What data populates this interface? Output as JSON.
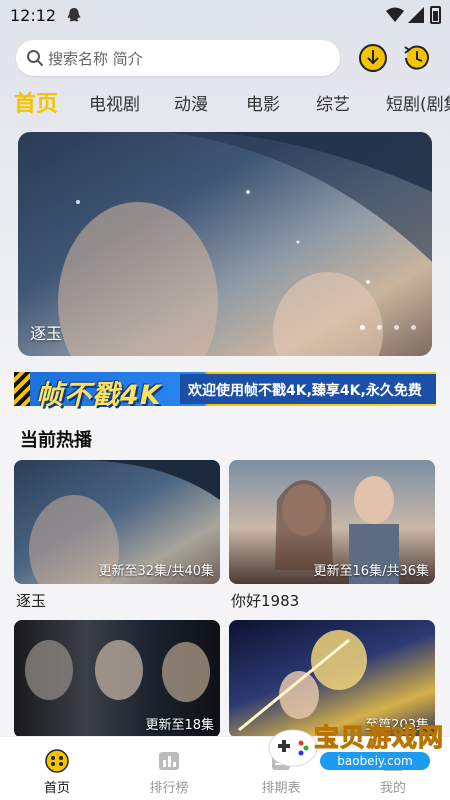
{
  "status_bar": {
    "time": "12:12"
  },
  "search": {
    "placeholder": "搜索名称 简介"
  },
  "tabs": [
    {
      "label": "首页",
      "active": true
    },
    {
      "label": "电视剧"
    },
    {
      "label": "动漫"
    },
    {
      "label": "电影"
    },
    {
      "label": "综艺"
    },
    {
      "label": "短剧(剧集"
    }
  ],
  "banner": {
    "title": "逐玉",
    "page_count": 4,
    "current_page": 1
  },
  "promo": {
    "left_text": "帧不戳4K",
    "right_text": "欢迎使用帧不戳4K,臻享4K,永久免费"
  },
  "section": {
    "title": "当前热播"
  },
  "cards": [
    {
      "title": "逐玉",
      "status": "更新至32集/共40集"
    },
    {
      "title": "你好1983",
      "status": "更新至16集/共36集"
    },
    {
      "title": "",
      "status": "更新至18集"
    },
    {
      "title": "",
      "status": "至第203集"
    }
  ],
  "bottom_nav": [
    {
      "label": "首页",
      "icon": "home-icon",
      "active": true
    },
    {
      "label": "排行榜",
      "icon": "ranking-icon"
    },
    {
      "label": "排期表",
      "icon": "schedule-icon"
    },
    {
      "label": "我的",
      "icon": "profile-icon"
    }
  ],
  "watermark": {
    "text": "宝贝游戏网",
    "url": "baobeiy.com"
  },
  "colors": {
    "accent": "#f5c400",
    "background": "#f4f4f6"
  }
}
